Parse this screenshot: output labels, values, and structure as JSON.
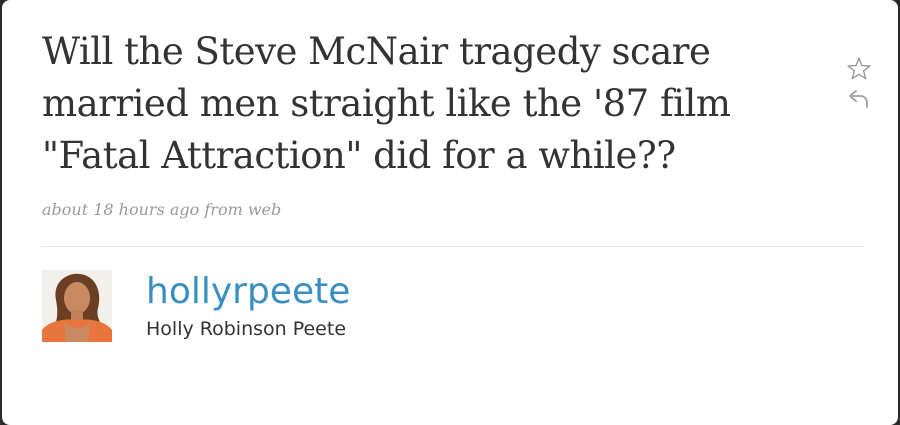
{
  "tweet": {
    "text": "Will the Steve McNair tragedy scare married men straight like the '87 film \"Fatal Attraction\" did for a while??",
    "time_label": "about 18 hours ago",
    "source_prefix": " from ",
    "source_label": "web"
  },
  "actions": {
    "favorite_icon": "star-outline",
    "reply_icon": "reply-arrow"
  },
  "user": {
    "handle": "hollyrpeete",
    "full_name": "Holly Robinson Peete"
  },
  "colors": {
    "link": "#3a8fc2",
    "text": "#333333",
    "meta": "#999999"
  }
}
